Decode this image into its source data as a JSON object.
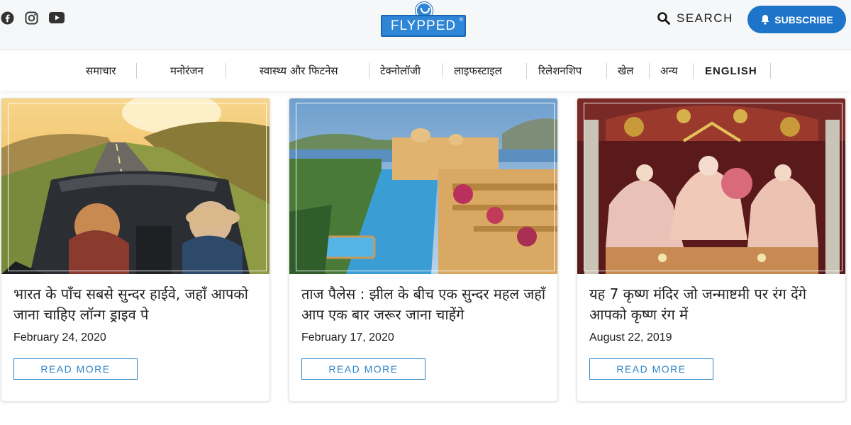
{
  "header": {
    "social": [
      {
        "icon": "facebook-icon"
      },
      {
        "icon": "instagram-icon"
      },
      {
        "icon": "youtube-icon"
      }
    ],
    "logo_text": "FLYPPED",
    "logo_mark": "®",
    "search_label": "SEARCH",
    "subscribe_label": "SUBSCRIBE"
  },
  "nav": {
    "items": [
      {
        "label": "समाचार"
      },
      {
        "label": "मनोरंजन"
      },
      {
        "label": "स्वास्थ्य और फिटनेस"
      },
      {
        "label": "टेक्नोलॉजी"
      },
      {
        "label": "लाइफस्टाइल"
      },
      {
        "label": "रिलेशनशिप"
      },
      {
        "label": "खेल"
      },
      {
        "label": "अन्य"
      },
      {
        "label": "ENGLISH"
      }
    ]
  },
  "cards": [
    {
      "title": "भारत के पाँच सबसे सुन्दर हाईवे, जहाँ आपको जाना चाहिए लॉन्ग ड्राइव पे",
      "date": "February 24, 2020",
      "cta": "READ MORE"
    },
    {
      "title": "ताज पैलेस : झील के बीच एक सुन्दर महल जहाँ आप एक बार जरूर जाना चाहेंगे",
      "date": "February 17, 2020",
      "cta": "READ MORE"
    },
    {
      "title": "यह 7 कृष्ण मंदिर जो जन्माष्टमी पर रंग देंगे आपको कृष्ण रंग में",
      "date": "August 22, 2019",
      "cta": "READ MORE"
    }
  ],
  "colors": {
    "brand_blue": "#1e74c9",
    "link_blue": "#2b83c9",
    "header_bg": "#f6f7f8"
  }
}
